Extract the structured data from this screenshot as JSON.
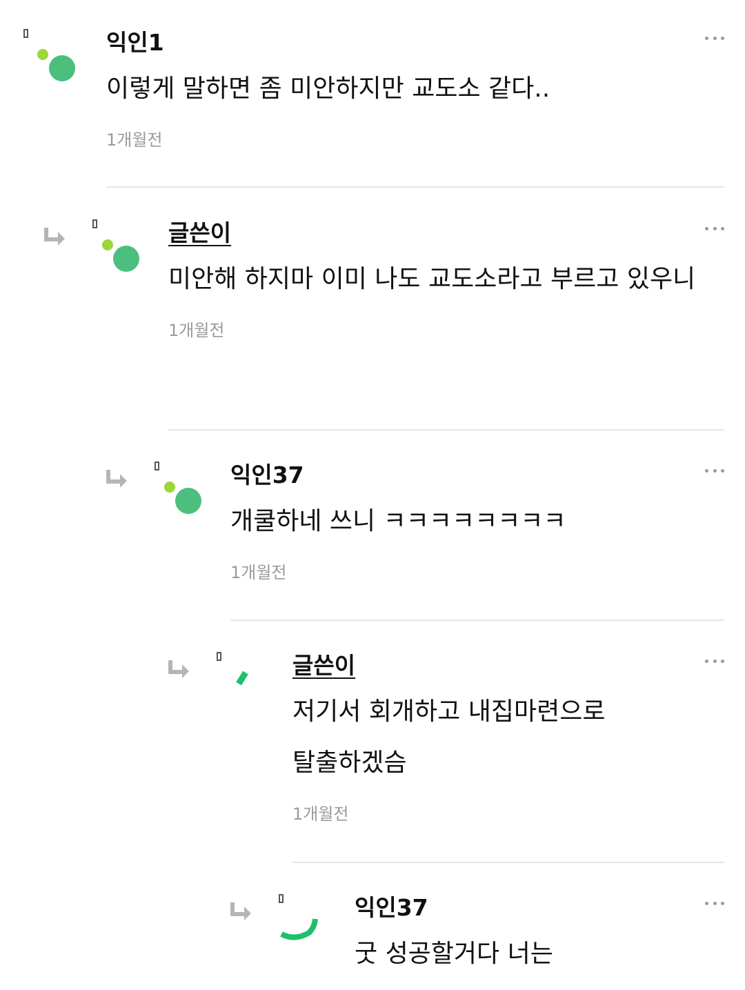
{
  "comments": [
    {
      "author": "익인1",
      "text": "이렇게 말하면 좀 미안하지만 교도소 같다..",
      "time": "1개월전"
    },
    {
      "author": "글쓴이",
      "text": "미안해 하지마 이미 나도 교도소라고 부르고 있우니",
      "time": "1개월전"
    },
    {
      "author": "익인37",
      "text": "개쿨하네 쓰니 ㅋㅋㅋㅋㅋㅋㅋㅋ",
      "time": "1개월전"
    },
    {
      "author": "글쓴이",
      "text": "저기서 회개하고 내집마련으로 탈출하겠슴",
      "time": "1개월전"
    },
    {
      "author": "익인37",
      "text": "굿 성공할거다 너는"
    }
  ],
  "colors": {
    "avatar_green": "#4cbf7e",
    "avatar_lime": "#9bd63b",
    "spinner_green": "#1fbf6b",
    "divider": "#e6e6e6",
    "time_gray": "#9a9a9a"
  },
  "icons": {
    "reply": "reply-arrow-icon",
    "more": "more-options-icon",
    "avatar": "avatar-icon",
    "loading": "loading-spinner-icon"
  }
}
